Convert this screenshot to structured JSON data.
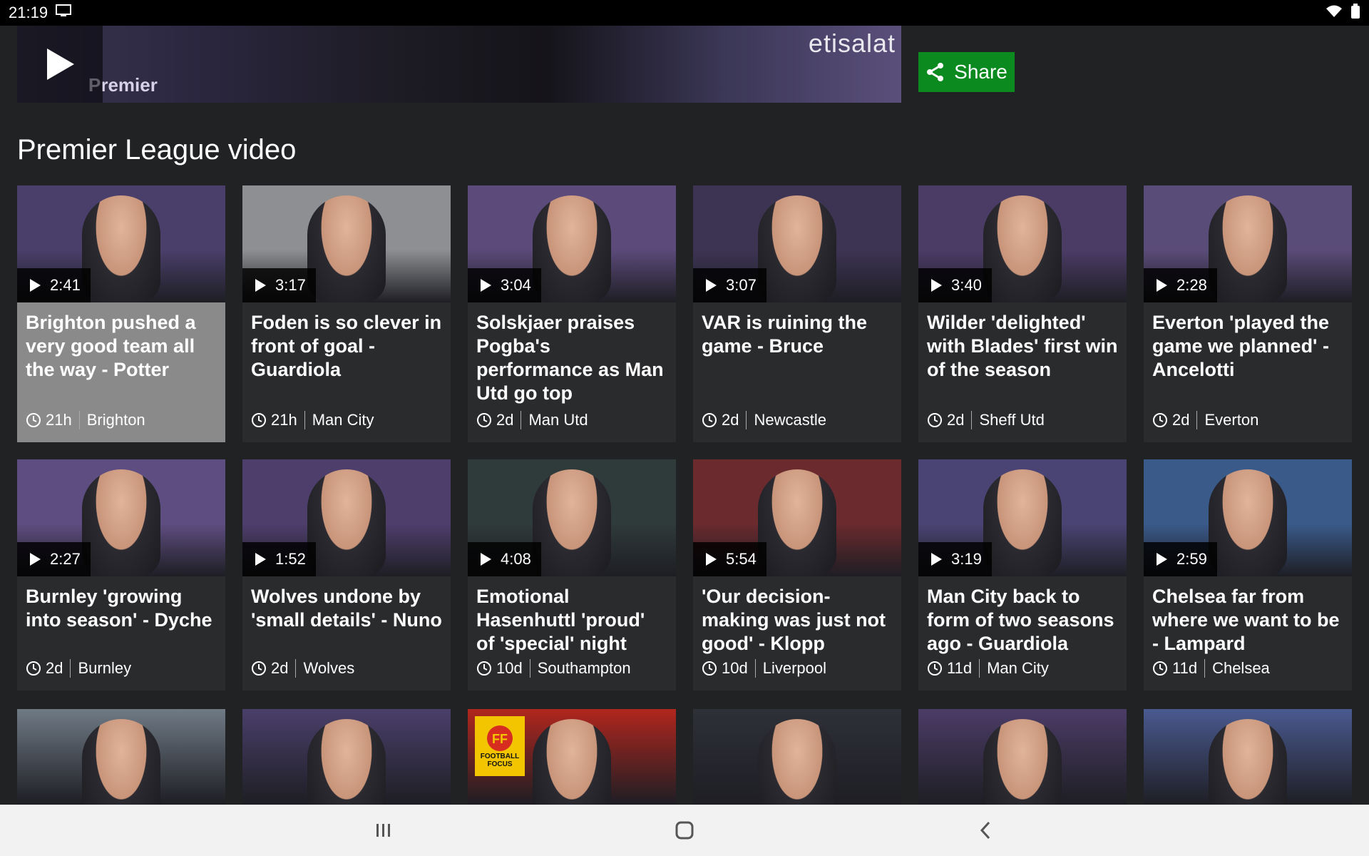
{
  "status_bar": {
    "time": "21:19"
  },
  "hero": {
    "sponsor_text": "etisalat",
    "league_text": "Premier",
    "share_label": "Share"
  },
  "section_title": "Premier League video",
  "colors": {
    "share": "#0b8a1f",
    "background": "#202224",
    "card": "#2a2b2d",
    "selected_card": "#8a8a8a"
  },
  "cards": [
    {
      "duration": "2:41",
      "title": "Brighton pushed a very good team all the way - Potter",
      "ago": "21h",
      "team": "Brighton",
      "bg": "#4a3f6a",
      "selected": true
    },
    {
      "duration": "3:17",
      "title": "Foden is so clever in front of goal - Guardiola",
      "ago": "21h",
      "team": "Man City",
      "bg": "#8d8f92"
    },
    {
      "duration": "3:04",
      "title": "Solskjaer praises Pogba's performance as Man Utd go top",
      "ago": "2d",
      "team": "Man Utd",
      "bg": "#5b4a7a"
    },
    {
      "duration": "3:07",
      "title": "VAR is ruining the game - Bruce",
      "ago": "2d",
      "team": "Newcastle",
      "bg": "#3d3454"
    },
    {
      "duration": "3:40",
      "title": "Wilder 'delighted' with Blades' first win of the season",
      "ago": "2d",
      "team": "Sheff Utd",
      "bg": "#4b3c66"
    },
    {
      "duration": "2:28",
      "title": "Everton 'played the game we planned' - Ancelotti",
      "ago": "2d",
      "team": "Everton",
      "bg": "#5a4c78"
    },
    {
      "duration": "2:27",
      "title": "Burnley 'growing into season' - Dyche",
      "ago": "2d",
      "team": "Burnley",
      "bg": "#5e4d80"
    },
    {
      "duration": "1:52",
      "title": "Wolves undone by 'small details' - Nuno",
      "ago": "2d",
      "team": "Wolves",
      "bg": "#4e3e6c"
    },
    {
      "duration": "4:08",
      "title": "Emotional Hasenhuttl 'proud' of 'special' night",
      "ago": "10d",
      "team": "Southampton",
      "bg": "#2f3a3a"
    },
    {
      "duration": "5:54",
      "title": "'Our decision-making was just not good' - Klopp",
      "ago": "10d",
      "team": "Liverpool",
      "bg": "#6a2a2e"
    },
    {
      "duration": "3:19",
      "title": "Man City back to form of two seasons ago - Guardiola",
      "ago": "11d",
      "team": "Man City",
      "bg": "#4a4474"
    },
    {
      "duration": "2:59",
      "title": "Chelsea far from where we want to be - Lampard",
      "ago": "11d",
      "team": "Chelsea",
      "bg": "#3a5a8a"
    }
  ],
  "partial_row": [
    {
      "bg": "#6f7a85"
    },
    {
      "bg": "#4a3f6a"
    },
    {
      "bg": "#b0261e",
      "label": "FOOTBALL FOCUS"
    },
    {
      "bg": "#2e3038"
    },
    {
      "bg": "#4b3c66"
    },
    {
      "bg": "#4a5a90"
    }
  ]
}
